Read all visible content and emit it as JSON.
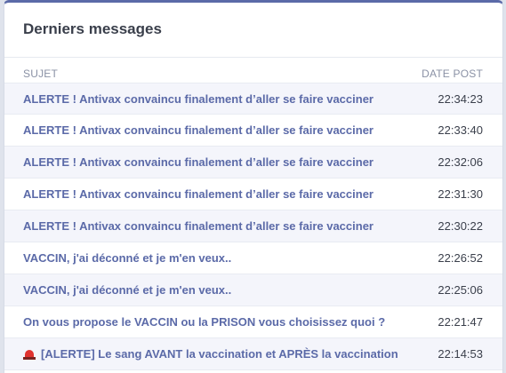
{
  "widget": {
    "title": "Derniers messages",
    "col_subject": "SUJET",
    "col_date": "DATE POST"
  },
  "messages": [
    {
      "subject": "ALERTE ! Antivax convaincu finalement d’aller se faire vacciner",
      "time": "22:34:23",
      "icon": ""
    },
    {
      "subject": "ALERTE ! Antivax convaincu finalement d’aller se faire vacciner",
      "time": "22:33:40",
      "icon": ""
    },
    {
      "subject": "ALERTE ! Antivax convaincu finalement d’aller se faire vacciner",
      "time": "22:32:06",
      "icon": ""
    },
    {
      "subject": "ALERTE ! Antivax convaincu finalement d’aller se faire vacciner",
      "time": "22:31:30",
      "icon": ""
    },
    {
      "subject": "ALERTE ! Antivax convaincu finalement d’aller se faire vacciner",
      "time": "22:30:22",
      "icon": ""
    },
    {
      "subject": "VACCIN, j'ai déconné et je m'en veux..",
      "time": "22:26:52",
      "icon": ""
    },
    {
      "subject": "VACCIN, j'ai déconné et je m'en veux..",
      "time": "22:25:06",
      "icon": ""
    },
    {
      "subject": "On vous propose le VACCIN ou la PRISON vous choisissez quoi ?",
      "time": "22:21:47",
      "icon": ""
    },
    {
      "subject": "[ALERTE] Le sang AVANT la vaccination et APRÈS la vaccination",
      "time": "22:14:53",
      "icon": "siren-icon"
    }
  ],
  "colors": {
    "accent": "#5b6aa8",
    "row_alt": "#f4f5fb",
    "text": "#3a3f4b"
  }
}
